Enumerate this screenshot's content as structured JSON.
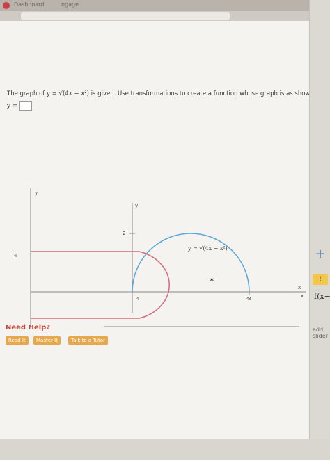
{
  "browser": {
    "tab_labels": [
      "Dashboard",
      "ngage"
    ]
  },
  "problem": {
    "prompt_text": "The graph of y = √(4x − x²) is given. Use transformations to create a function whose graph is as shown.",
    "answer_label": "y =",
    "answer_value": "",
    "formula_label": "y = √(4x − x²)",
    "axis_labels": {
      "y": "y",
      "x": "x"
    },
    "ticks": {
      "upper_y": "2",
      "upper_x": "4",
      "lower_y": "4",
      "lower_x_4": "4",
      "lower_x_8": "8"
    }
  },
  "buttons": {
    "need_help": "Need Help?",
    "read_it": "Read It",
    "master_it": "Master It",
    "talk_to_tutor": "Talk to a Tutor"
  },
  "sidepanel": {
    "plus": "+",
    "warn": "!",
    "f_label": "f(x−",
    "add_slider": "add slider"
  },
  "colors": {
    "blue_curve": "#5aa6d8",
    "red_curve": "#d26a7a",
    "accent": "#e6a84c",
    "help": "#c7463f"
  }
}
